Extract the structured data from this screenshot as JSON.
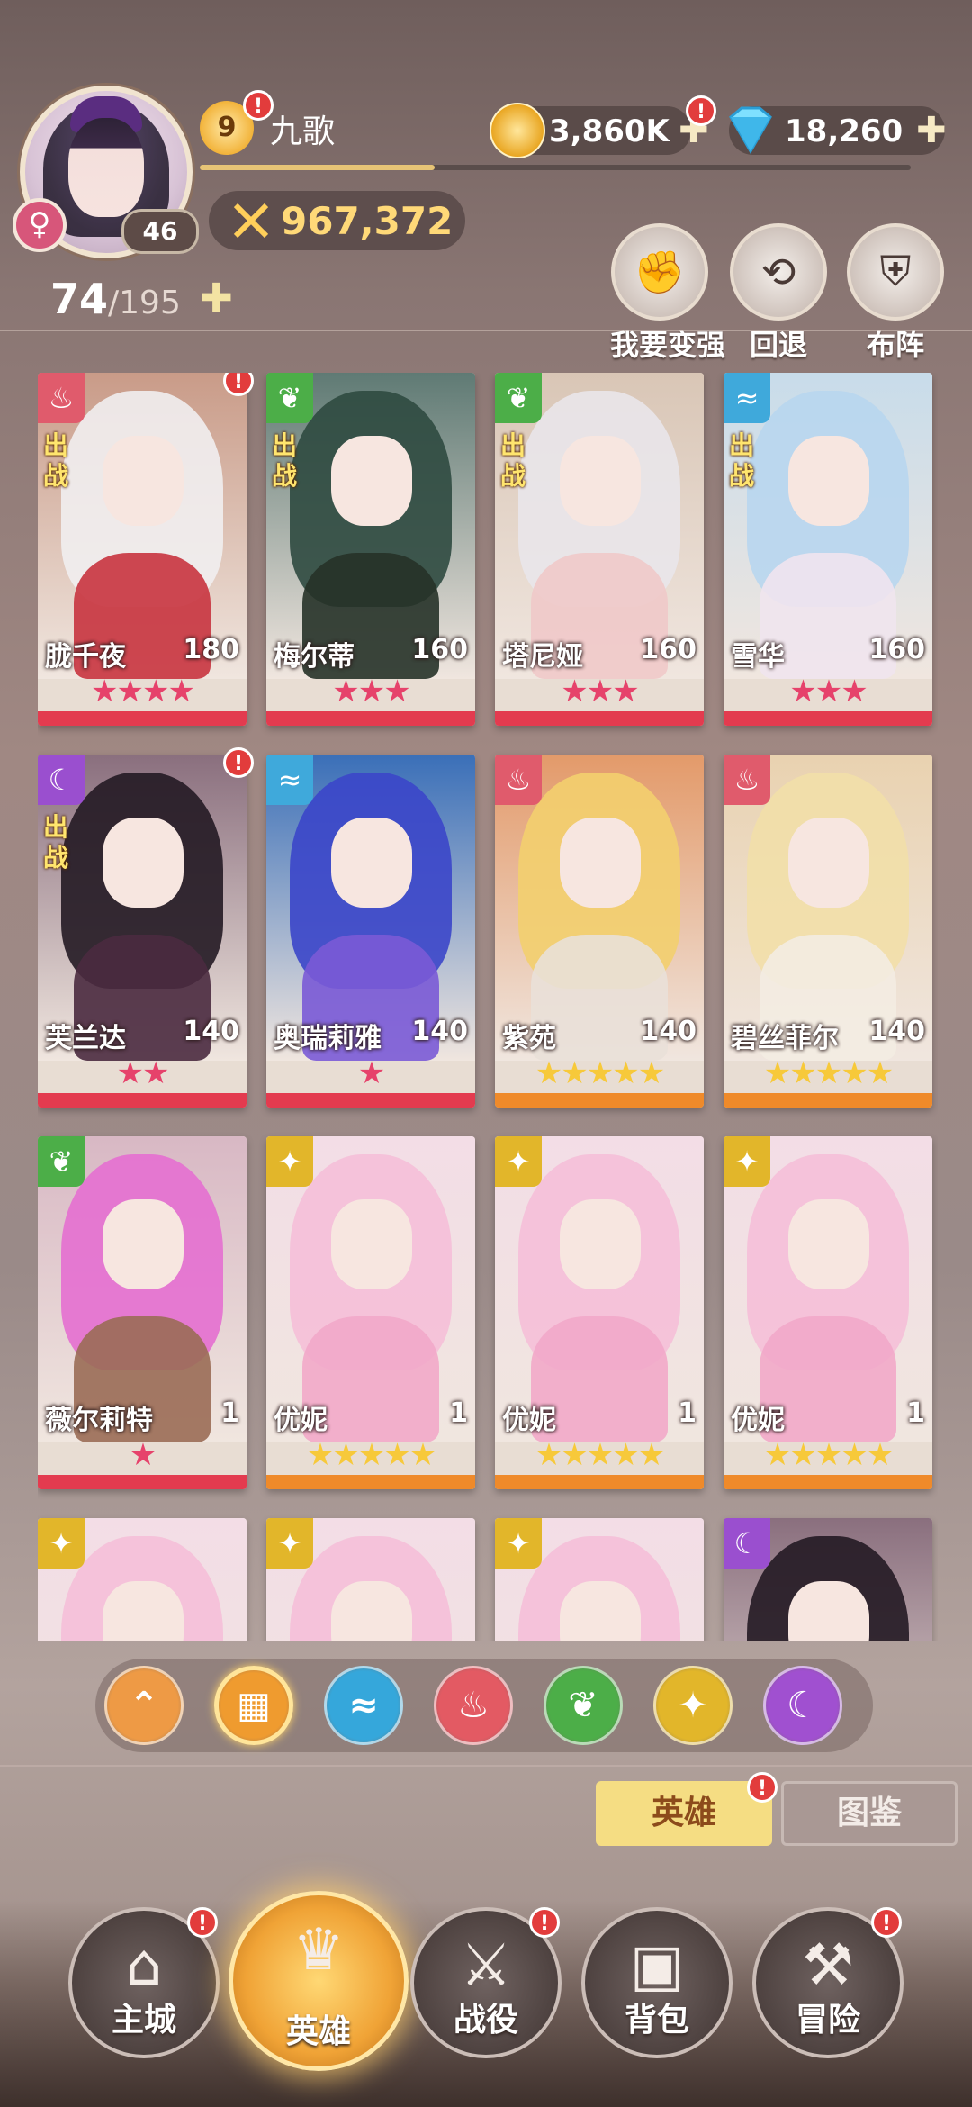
{
  "header": {
    "player_name": "九歌",
    "vip_level": "9",
    "avatar_level": "46",
    "gender_symbol": "♀",
    "exp_progress": 0.33,
    "combat_power": "967,372",
    "gold": "3,860K",
    "diamonds": "18,260",
    "roster_count": "74",
    "roster_max": "/195",
    "plus_glyph": "✚"
  },
  "actions": [
    {
      "label": "我要变强",
      "icon": "fist-icon",
      "glyph": "✊"
    },
    {
      "label": "回退",
      "icon": "rewind-icon",
      "glyph": "⟲"
    },
    {
      "label": "布阵",
      "icon": "shield-formation-icon",
      "glyph": "⛨"
    }
  ],
  "heroes": [
    {
      "name": "胧千夜",
      "level": "180",
      "element": "fire",
      "stars": "★★★★",
      "deployed": true,
      "badge": true,
      "star_color": "#e6426b",
      "bar": "#e33b4f",
      "hair": "#f1eef0",
      "body": "#c8343f",
      "bg": "#c99b88"
    },
    {
      "name": "梅尔蒂",
      "level": "160",
      "element": "nature",
      "stars": "★★★",
      "deployed": true,
      "badge": false,
      "star_color": "#e6426b",
      "bar": "#e33b4f",
      "hair": "#2f4a40",
      "body": "#263228",
      "bg": "#5f7a74"
    },
    {
      "name": "塔尼娅",
      "level": "160",
      "element": "nature",
      "stars": "★★★",
      "deployed": true,
      "badge": false,
      "star_color": "#e6426b",
      "bar": "#e33b4f",
      "hair": "#e9e6ea",
      "body": "#f0c9c9",
      "bg": "#d9c6b6"
    },
    {
      "name": "雪华",
      "level": "160",
      "element": "water",
      "stars": "★★★",
      "deployed": true,
      "badge": false,
      "star_color": "#e6426b",
      "bar": "#e33b4f",
      "hair": "#b8d6ee",
      "body": "#f0e4ee",
      "bg": "#c8dcea"
    },
    {
      "name": "芙兰达",
      "level": "140",
      "element": "dark",
      "stars": "★★",
      "deployed": true,
      "badge": true,
      "star_color": "#e6426b",
      "bar": "#e33b4f",
      "hair": "#231a24",
      "body": "#4a2a3f",
      "bg": "#8a6f7e"
    },
    {
      "name": "奥瑞莉雅",
      "level": "140",
      "element": "water",
      "stars": "★",
      "deployed": false,
      "badge": false,
      "star_color": "#e6426b",
      "bar": "#e33b4f",
      "hair": "#3b46c9",
      "body": "#7a5ad6",
      "bg": "#3a6fb8"
    },
    {
      "name": "紫苑",
      "level": "140",
      "element": "fire",
      "stars": "★★★★★",
      "deployed": false,
      "badge": false,
      "star_color": "#f7c93a",
      "bar": "#ef8a2a",
      "hair": "#f3cf6e",
      "body": "#e9e0d8",
      "bg": "#e39a6a"
    },
    {
      "name": "碧丝菲尔",
      "level": "140",
      "element": "fire",
      "stars": "★★★★★",
      "deployed": false,
      "badge": false,
      "star_color": "#f7c93a",
      "bar": "#ef8a2a",
      "hair": "#f2dfa8",
      "body": "#f3ece2",
      "bg": "#e9d2b0"
    },
    {
      "name": "薇尔莉特",
      "level": "1",
      "element": "nature",
      "stars": "★",
      "deployed": false,
      "badge": false,
      "star_color": "#e6426b",
      "bar": "#e33b4f",
      "hair": "#e46fd0",
      "body": "#9a6b55",
      "bg": "#d8b8c4"
    },
    {
      "name": "优妮",
      "level": "1",
      "element": "light",
      "stars": "★★★★★",
      "deployed": false,
      "badge": false,
      "star_color": "#f7c93a",
      "bar": "#ef8a2a",
      "hair": "#f5bfd8",
      "body": "#f2a8c9",
      "bg": "#f3dde6"
    },
    {
      "name": "优妮",
      "level": "1",
      "element": "light",
      "stars": "★★★★★",
      "deployed": false,
      "badge": false,
      "star_color": "#f7c93a",
      "bar": "#ef8a2a",
      "hair": "#f5bfd8",
      "body": "#f2a8c9",
      "bg": "#f3dde6"
    },
    {
      "name": "优妮",
      "level": "1",
      "element": "light",
      "stars": "★★★★★",
      "deployed": false,
      "badge": false,
      "star_color": "#f7c93a",
      "bar": "#ef8a2a",
      "hair": "#f5bfd8",
      "body": "#f2a8c9",
      "bg": "#f3dde6"
    },
    {
      "name": "",
      "level": "",
      "element": "light",
      "stars": "",
      "deployed": false,
      "badge": false,
      "star_color": "#f7c93a",
      "bar": "#ef8a2a",
      "hair": "#f5bfd8",
      "body": "#f2a8c9",
      "bg": "#f3dde6"
    },
    {
      "name": "",
      "level": "",
      "element": "light",
      "stars": "",
      "deployed": false,
      "badge": false,
      "star_color": "#f7c93a",
      "bar": "#ef8a2a",
      "hair": "#f5bfd8",
      "body": "#f2a8c9",
      "bg": "#f3dde6"
    },
    {
      "name": "",
      "level": "",
      "element": "light",
      "stars": "",
      "deployed": false,
      "badge": false,
      "star_color": "#f7c93a",
      "bar": "#ef8a2a",
      "hair": "#f5bfd8",
      "body": "#f2a8c9",
      "bg": "#f3dde6"
    },
    {
      "name": "",
      "level": "",
      "element": "dark",
      "stars": "",
      "deployed": false,
      "badge": false,
      "star_color": "#e6426b",
      "bar": "#e33b4f",
      "hair": "#231a24",
      "body": "#4a2a3f",
      "bg": "#8a6f7e"
    }
  ],
  "deploy_label": "出战",
  "elements": {
    "fire": {
      "color": "#e05b6c",
      "glyph": "♨",
      "icon": "fire-element-icon"
    },
    "nature": {
      "color": "#4cae48",
      "glyph": "❦",
      "icon": "leaf-element-icon"
    },
    "water": {
      "color": "#3fa9db",
      "glyph": "≈",
      "icon": "wave-element-icon"
    },
    "dark": {
      "color": "#9a4fcf",
      "glyph": "☾",
      "icon": "dark-element-icon"
    },
    "light": {
      "color": "#e2b62a",
      "glyph": "✦",
      "icon": "light-element-icon"
    }
  },
  "filters": [
    {
      "icon": "chevron-up-icon",
      "glyph": "⌃",
      "color": "#ee9a45"
    },
    {
      "icon": "grid-all-icon",
      "glyph": "▦",
      "color": "#ef9b2f",
      "selected": true
    },
    {
      "icon": "wave-element-icon",
      "glyph": "≈",
      "color": "#35a7db"
    },
    {
      "icon": "fire-element-icon",
      "glyph": "♨",
      "color": "#e35a63"
    },
    {
      "icon": "leaf-element-icon",
      "glyph": "❦",
      "color": "#4cae48"
    },
    {
      "icon": "light-element-icon",
      "glyph": "✦",
      "color": "#e2b62a"
    },
    {
      "icon": "dark-element-icon",
      "glyph": "☾",
      "color": "#a050d0"
    }
  ],
  "tabs": {
    "hero": "英雄",
    "codex": "图鉴"
  },
  "nav": [
    {
      "label": "主城",
      "icon": "castle-icon",
      "glyph": "⌂",
      "badge": true
    },
    {
      "label": "英雄",
      "icon": "hero-icon",
      "glyph": "♛",
      "active": true
    },
    {
      "label": "战役",
      "icon": "wings-sword-icon",
      "glyph": "⚔",
      "badge": true
    },
    {
      "label": "背包",
      "icon": "backpack-icon",
      "glyph": "▣",
      "badge": false
    },
    {
      "label": "冒险",
      "icon": "adventure-icon",
      "glyph": "⚒",
      "badge": true
    }
  ],
  "alert_glyph": "!"
}
